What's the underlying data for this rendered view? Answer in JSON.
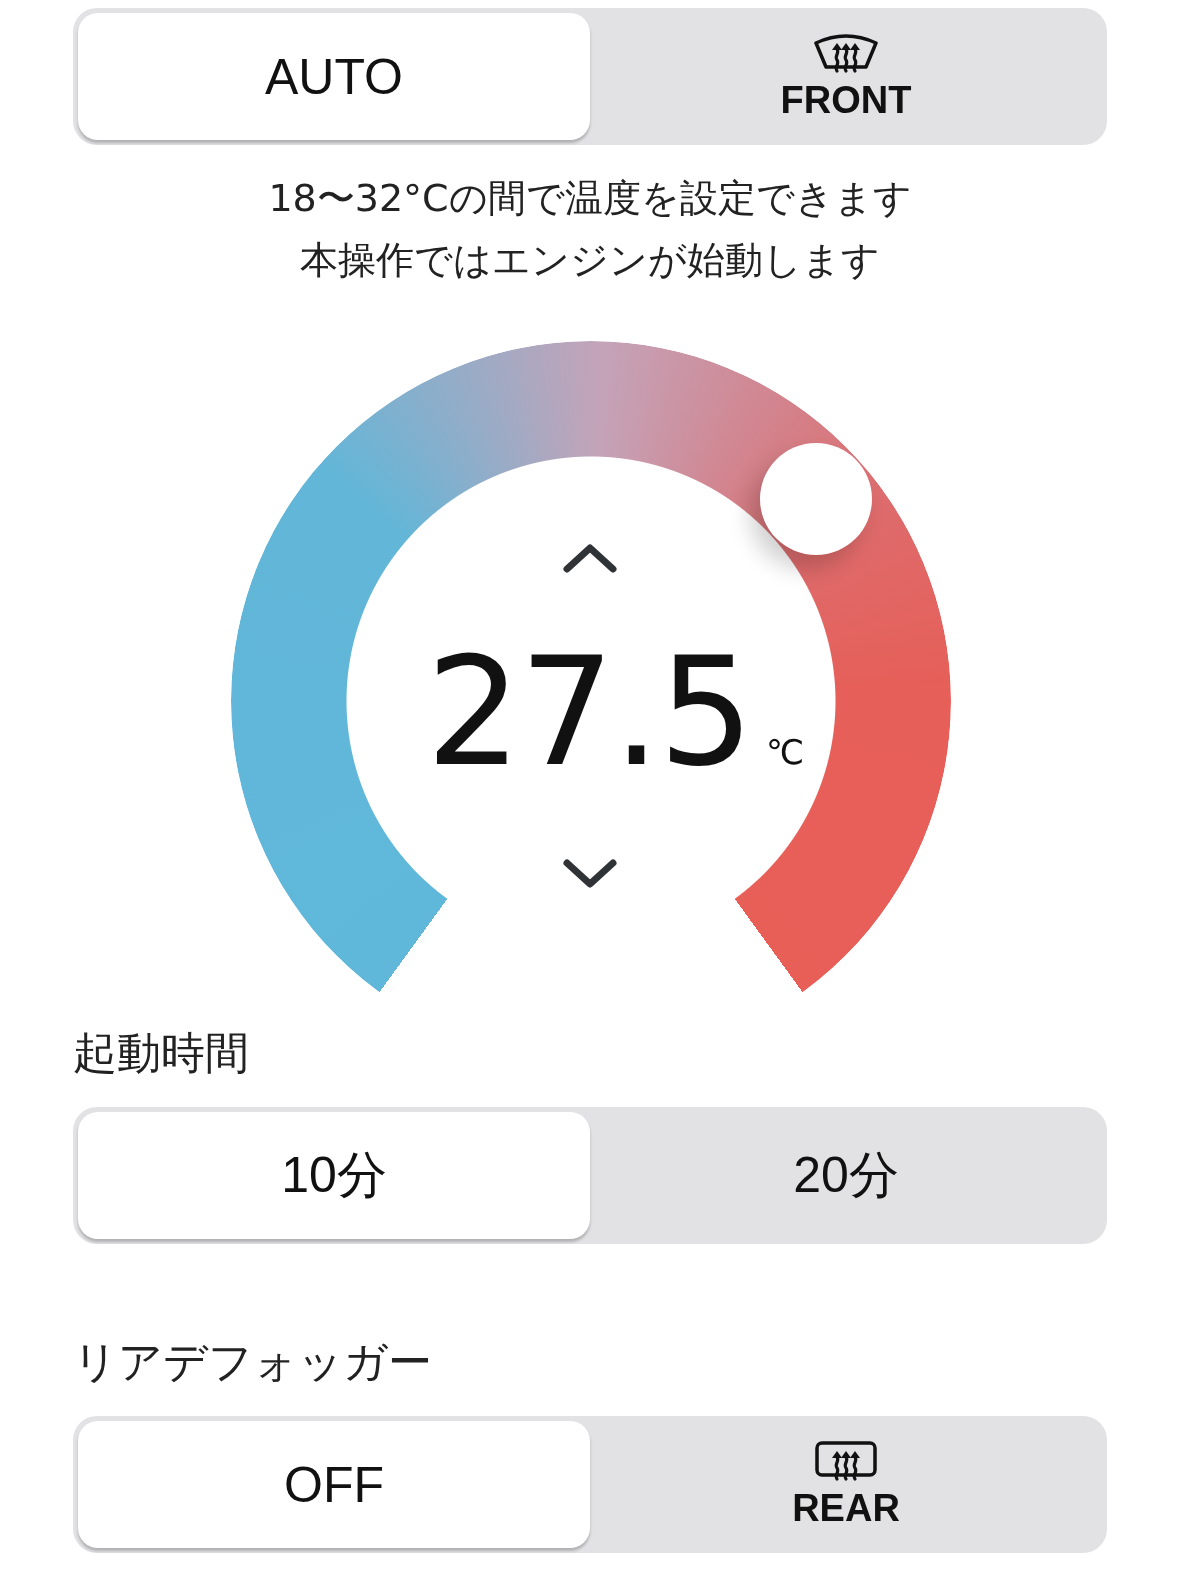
{
  "mode_toggle": {
    "options": [
      {
        "label": "AUTO",
        "kind": "text",
        "selected": true
      },
      {
        "label": "FRONT",
        "kind": "windshield",
        "selected": false
      }
    ]
  },
  "notes": [
    "18〜32°Cの間で温度を設定できます",
    "本操作ではエンジンが始動します"
  ],
  "temperature": {
    "value": "27.5",
    "unit": "℃"
  },
  "start_time": {
    "label": "起動時間",
    "options": [
      {
        "label": "10分",
        "kind": "text",
        "selected": true
      },
      {
        "label": "20分",
        "kind": "text",
        "selected": false
      }
    ]
  },
  "rear_defogger": {
    "label": "リアデフォッガー",
    "options": [
      {
        "label": "OFF",
        "kind": "text",
        "selected": true
      },
      {
        "label": "REAR",
        "kind": "rearwindow",
        "selected": false
      }
    ]
  }
}
